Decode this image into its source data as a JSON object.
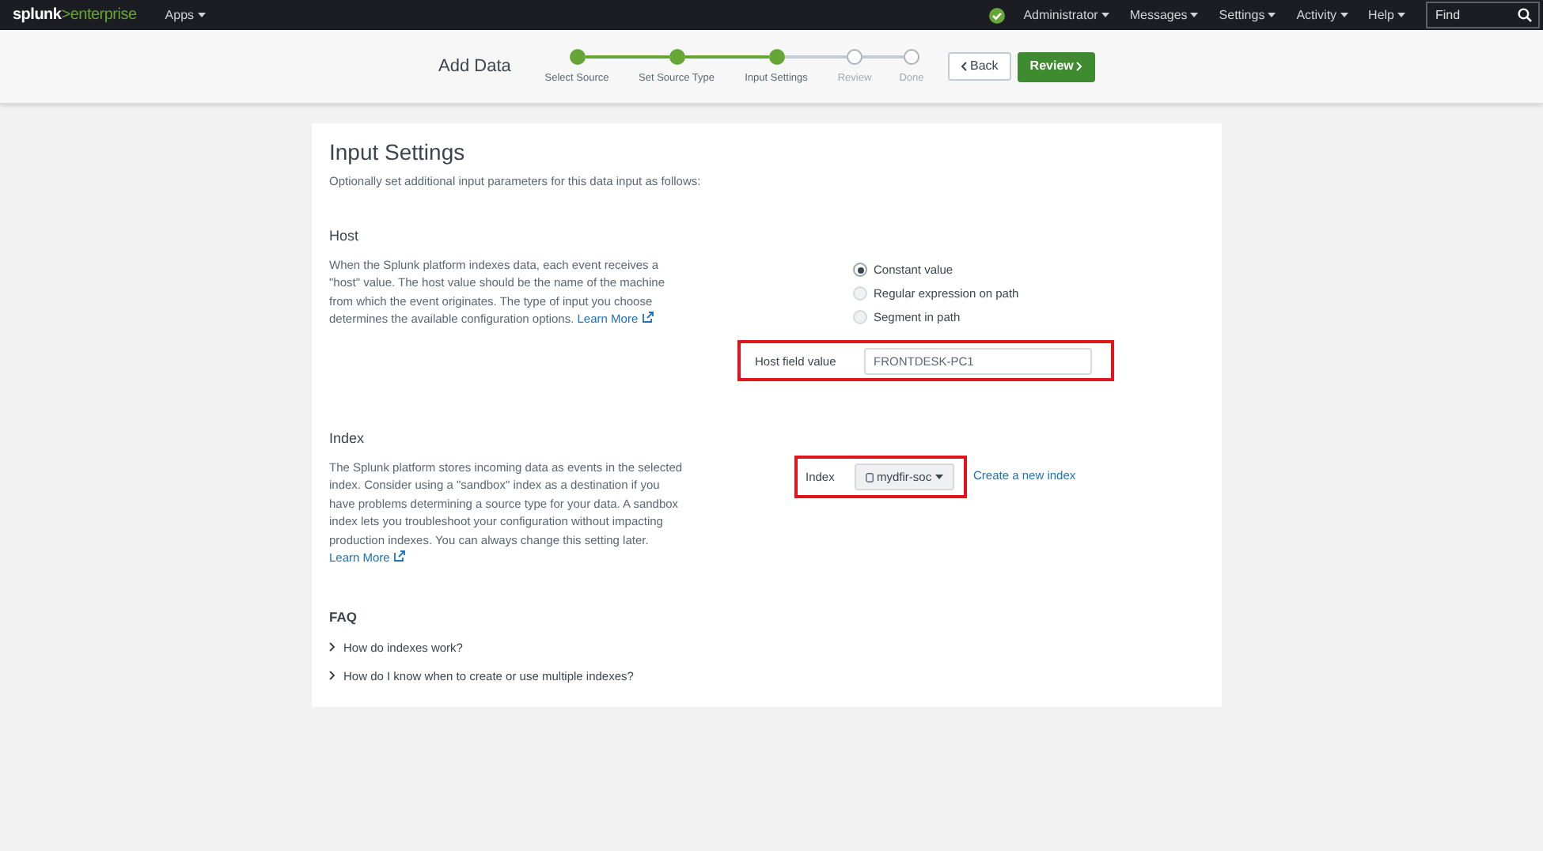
{
  "topbar": {
    "logo_brand": "splunk",
    "logo_product": ">enterprise",
    "apps": "Apps",
    "menus": [
      "Administrator",
      "Messages",
      "Settings",
      "Activity",
      "Help"
    ],
    "search": {
      "placeholder": "Find"
    }
  },
  "wizard": {
    "title": "Add Data",
    "steps": [
      {
        "label": "Select Source",
        "done": true
      },
      {
        "label": "Set Source Type",
        "done": true
      },
      {
        "label": "Input Settings",
        "done": true
      },
      {
        "label": "Review",
        "done": false
      },
      {
        "label": "Done",
        "done": false
      }
    ],
    "back": "Back",
    "next": "Review"
  },
  "page": {
    "title": "Input Settings",
    "subtitle": "Optionally set additional input parameters for this data input as follows:"
  },
  "host": {
    "heading": "Host",
    "description": "When the Splunk platform indexes data, each event receives a \"host\" value. The host value should be the name of the machine from which the event originates. The type of input you choose determines the available configuration options.",
    "link": "Learn More",
    "options": [
      {
        "label": "Constant value",
        "selected": true
      },
      {
        "label": "Regular expression on path",
        "selected": false
      },
      {
        "label": "Segment in path",
        "selected": false
      }
    ],
    "field_label": "Host field value",
    "field_value": "FRONTDESK-PC1",
    "highlighted": true
  },
  "index": {
    "heading": "Index",
    "description": "The Splunk platform stores incoming data as events in the selected index. Consider using a \"sandbox\" index as a destination if you have problems determining a source type for your data. A sandbox index lets you troubleshoot your configuration without impacting production indexes. You can always change this setting later.",
    "link": "Learn More",
    "field_label": "Index",
    "value": "mydfir-soc",
    "create_link": "Create a new index",
    "highlighted": true
  },
  "faq": {
    "heading": "FAQ",
    "items": [
      {
        "label": "How do indexes work?",
        "expanded": false
      },
      {
        "label": "How do I know when to create or use multiple indexes?",
        "expanded": false
      }
    ]
  }
}
